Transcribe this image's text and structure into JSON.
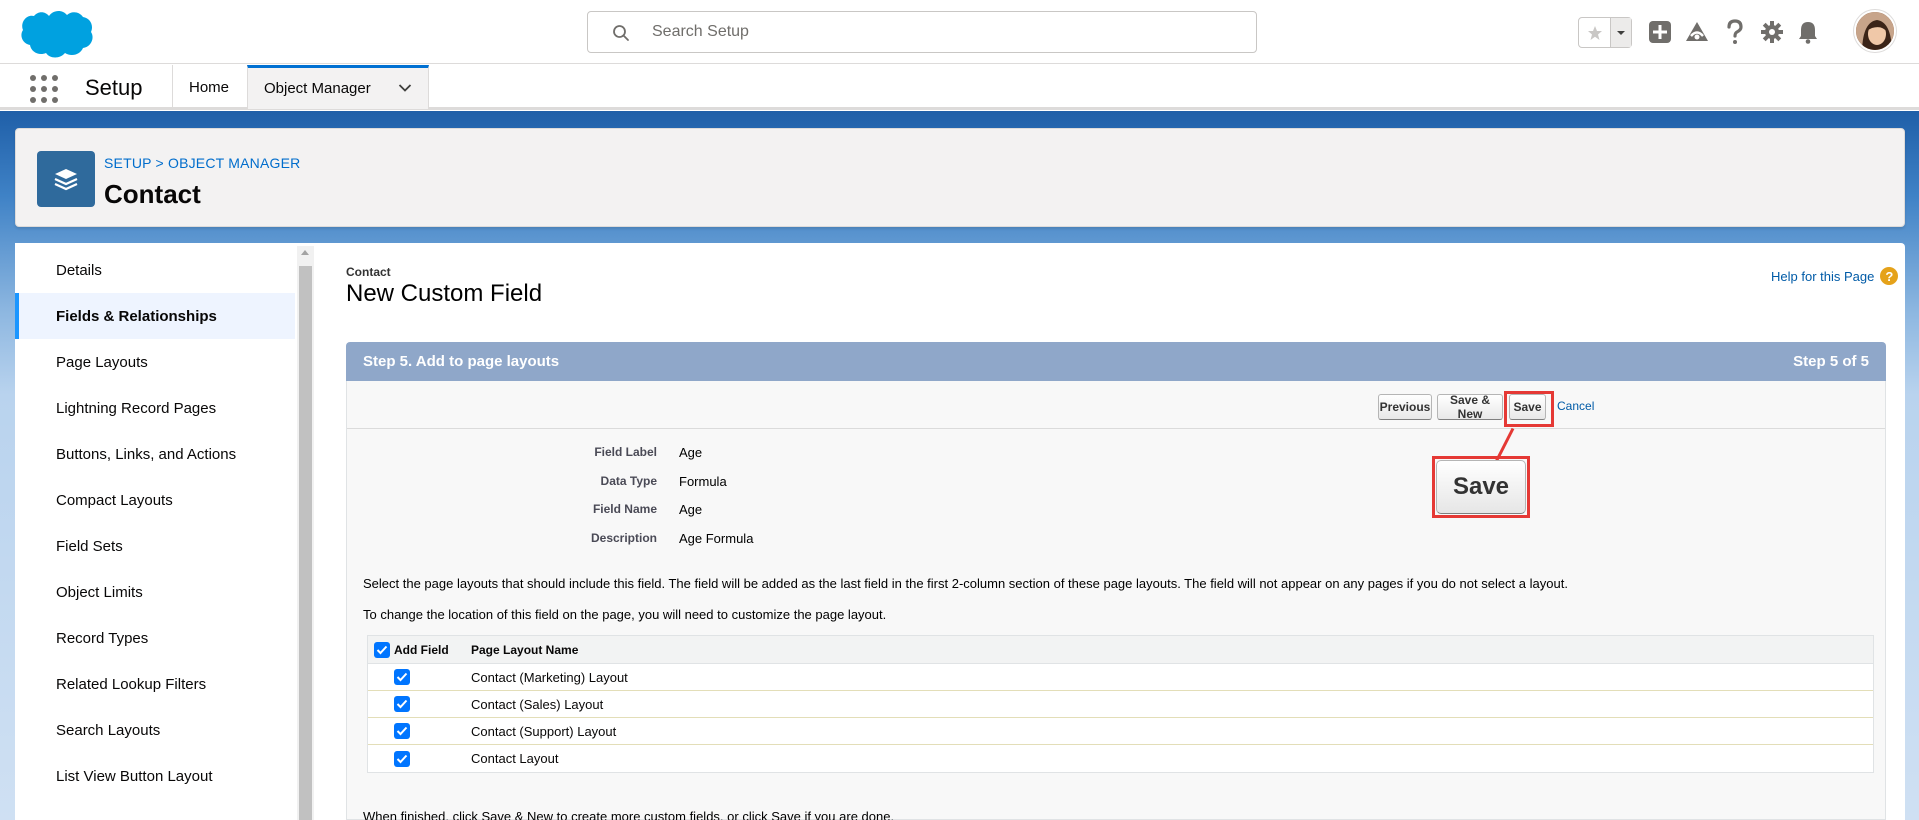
{
  "header": {
    "search_placeholder": "Search Setup",
    "icons": [
      "favorites-star-icon",
      "favorites-caret-icon",
      "global-actions-add-icon",
      "trailhead-icon",
      "help-icon",
      "setup-gear-icon",
      "notifications-bell-icon",
      "user-avatar"
    ]
  },
  "nav": {
    "app_name": "Setup",
    "tabs": [
      {
        "label": "Home",
        "active": false
      },
      {
        "label": "Object Manager",
        "active": true
      }
    ]
  },
  "page_header": {
    "breadcrumb": "SETUP > OBJECT MANAGER",
    "title": "Contact"
  },
  "sidebar": {
    "items": [
      {
        "label": "Details",
        "active": false
      },
      {
        "label": "Fields & Relationships",
        "active": true
      },
      {
        "label": "Page Layouts",
        "active": false
      },
      {
        "label": "Lightning Record Pages",
        "active": false
      },
      {
        "label": "Buttons, Links, and Actions",
        "active": false
      },
      {
        "label": "Compact Layouts",
        "active": false
      },
      {
        "label": "Field Sets",
        "active": false
      },
      {
        "label": "Object Limits",
        "active": false
      },
      {
        "label": "Record Types",
        "active": false
      },
      {
        "label": "Related Lookup Filters",
        "active": false
      },
      {
        "label": "Search Layouts",
        "active": false
      },
      {
        "label": "List View Button Layout",
        "active": false
      }
    ]
  },
  "main": {
    "subtitle": "Contact",
    "title": "New Custom Field",
    "help_link": "Help for this Page",
    "step_title": "Step 5. Add to page layouts",
    "step_counter": "Step 5 of 5",
    "buttons": {
      "previous": "Previous",
      "save_new": "Save & New",
      "save": "Save",
      "cancel": "Cancel",
      "save_zoomed": "Save"
    },
    "details": [
      {
        "label": "Field Label",
        "value": "Age"
      },
      {
        "label": "Data Type",
        "value": "Formula"
      },
      {
        "label": "Field Name",
        "value": "Age"
      },
      {
        "label": "Description",
        "value": "Age Formula"
      }
    ],
    "instructions": [
      "Select the page layouts that should include this field. The field will be added as the last field in the first 2-column section of these page layouts. The field will not appear on any pages if you do not select a layout.",
      "To change the location of this field on the page, you will need to customize the page layout."
    ],
    "table": {
      "headers": [
        "Add Field",
        "Page Layout Name"
      ],
      "rows": [
        {
          "checked": true,
          "name": "Contact (Marketing) Layout"
        },
        {
          "checked": true,
          "name": "Contact (Sales) Layout"
        },
        {
          "checked": true,
          "name": "Contact (Support) Layout"
        },
        {
          "checked": true,
          "name": "Contact Layout"
        }
      ]
    },
    "footer_text": "When finished, click Save & New to create more custom fields, or click Save if you are done."
  },
  "colors": {
    "brand_blue": "#00a1e0",
    "link_blue": "#015ba7",
    "step_bar": "#8fa7c9",
    "highlight_red": "#e53935",
    "object_icon": "#2f6a9c"
  }
}
